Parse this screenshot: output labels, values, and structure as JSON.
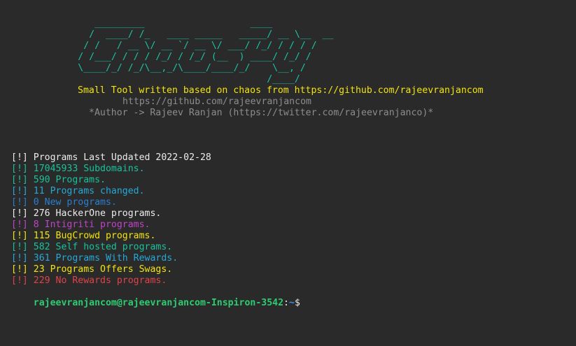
{
  "banner": {
    "art": "               _________                   ____\n              /  ____/ /_   ____ _____   _____/ __ \\__  __\n             / /   / __ \\/ __ `/ __ \\/ ___/ /_/ / / / /\n            / /___/ / / / /_/ / /_/ (__  ) ____/ /_/ /\n            \\____/_/ /_/\\__,_/\\____/____/_/    \\__, /\n                                              /____/",
    "subtitle": "Small Tool written based on chaos from https://github.com/rajeevranjancom",
    "url": "https://github.com/rajeevranjancom",
    "author": "*Author -> Rajeev Ranjan (https://twitter.com/rajeevranjanco)*"
  },
  "lines": [
    {
      "text": "[!] Programs Last Updated 2022-02-28",
      "color": "#ececec"
    },
    {
      "text": "[!] 17045933 Subdomains.",
      "color": "#17c39a"
    },
    {
      "text": "[!] 590 Programs.",
      "color": "#17c39a"
    },
    {
      "text": "[!] 11 Programs changed.",
      "color": "#26a9d8"
    },
    {
      "text": "[!] 0 New programs.",
      "color": "#2b7fd1"
    },
    {
      "text": "[!] 276 HackerOne programs.",
      "color": "#ececec"
    },
    {
      "text": "[!] 8 Intigriti programs.",
      "color": "#c043c9"
    },
    {
      "text": "[!] 115 BugCrowd programs.",
      "color": "#f2e40c"
    },
    {
      "text": "[!] 582 Self hosted programs.",
      "color": "#17c39a"
    },
    {
      "text": "[!] 361 Programs With Rewards.",
      "color": "#26a9d8"
    },
    {
      "text": "[!] 23 Programs Offers Swags.",
      "color": "#f2e40c"
    },
    {
      "text": "[!] 229 No Rewards programs.",
      "color": "#e0434a"
    }
  ],
  "prompt": {
    "user_host": "rajeevranjancom@rajeevranjancom-Inspiron-3542",
    "separator": ":",
    "path": "~",
    "symbol": "$"
  },
  "colors": {
    "background": "#2a2a2a",
    "banner": "#19c4a3",
    "subtitle": "#f2e40c",
    "muted": "#8d8d8d"
  }
}
